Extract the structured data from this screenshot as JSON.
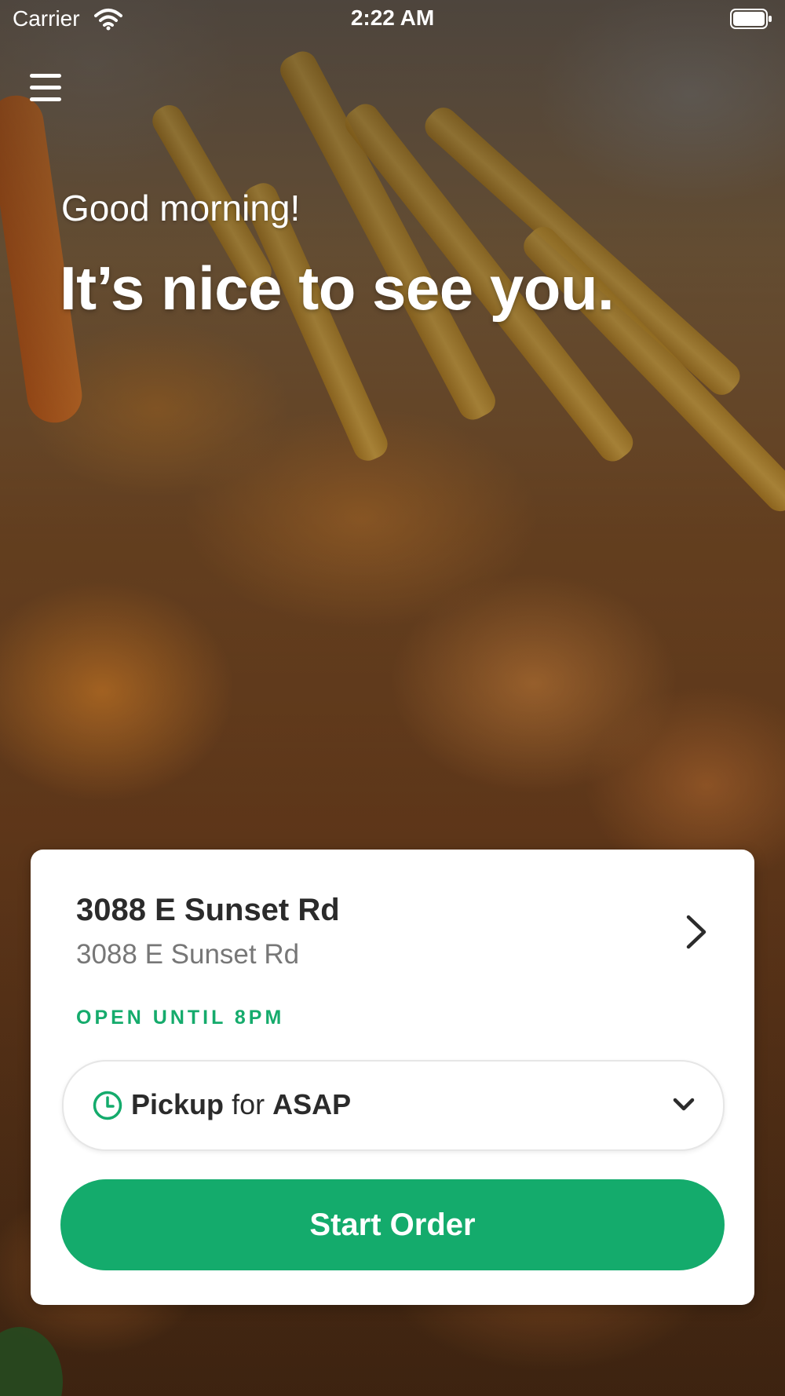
{
  "status_bar": {
    "carrier": "Carrier",
    "time": "2:22 AM",
    "wifi_icon": "wifi-icon",
    "battery_icon": "battery-icon"
  },
  "header": {
    "menu_icon": "hamburger-menu-icon",
    "greeting": "Good morning!",
    "headline": "It’s nice to see you."
  },
  "location_card": {
    "name": "3088 E Sunset Rd",
    "address": "3088 E Sunset Rd",
    "hours": "OPEN UNTIL 8PM",
    "chevron_icon": "chevron-right-icon",
    "order_type": {
      "clock_icon": "clock-icon",
      "mode": "Pickup",
      "connector": "for",
      "time": "ASAP",
      "dropdown_icon": "chevron-down-icon"
    },
    "start_order_label": "Start Order"
  },
  "colors": {
    "accent": "#14ab6c",
    "card_background": "#ffffff",
    "primary_text": "#2b2b2b",
    "secondary_text": "#777777"
  }
}
